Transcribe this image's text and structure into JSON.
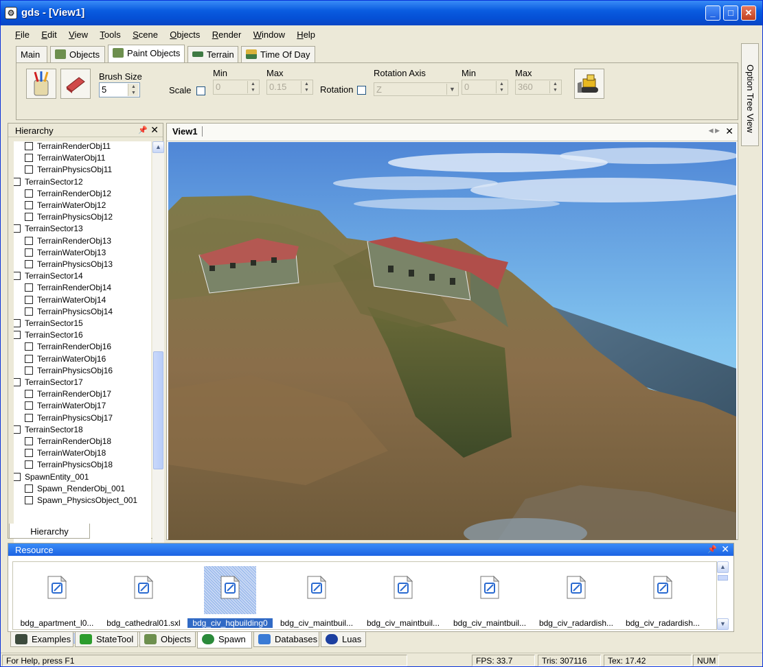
{
  "window": {
    "app_icon": "gds-app-icon",
    "title": "gds - [View1]",
    "min_label": "_",
    "max_label": "□",
    "close_label": "✕"
  },
  "menu": [
    "File",
    "Edit",
    "View",
    "Tools",
    "Scene",
    "Objects",
    "Render",
    "Window",
    "Help"
  ],
  "toolbar_tabs": [
    {
      "label": "Main",
      "icon": ""
    },
    {
      "label": "Objects",
      "icon": "objects-icon",
      "color": "#6d8f4e"
    },
    {
      "label": "Paint Objects",
      "icon": "paint-objects-icon",
      "color": "#6d8f4e"
    },
    {
      "label": "Terrain",
      "icon": "terrain-icon",
      "color": "#3f7a44"
    },
    {
      "label": "Time Of Day",
      "icon": "time-of-day-icon",
      "color": "#d9b23a"
    }
  ],
  "paint": {
    "brush_label": "Brush Size",
    "brush_value": "5",
    "scale_label": "Scale",
    "min_label": "Min",
    "max_label": "Max",
    "scale_min": "0",
    "scale_max": "0.15",
    "rotation_label": "Rotation",
    "rotation_axis_label": "Rotation Axis",
    "rotation_axis_value": "Z",
    "rot_min": "0",
    "rot_max": "360"
  },
  "option_tree": "Option Tree View",
  "hierarchy": {
    "title": "Hierarchy",
    "tab_label": "Hierarchy",
    "rows": [
      {
        "label": "TerrainRenderObj11",
        "indent": 1
      },
      {
        "label": "TerrainWaterObj11",
        "indent": 1
      },
      {
        "label": "TerrainPhysicsObj11",
        "indent": 1
      },
      {
        "label": "TerrainSector12",
        "indent": 0
      },
      {
        "label": "TerrainRenderObj12",
        "indent": 1
      },
      {
        "label": "TerrainWaterObj12",
        "indent": 1
      },
      {
        "label": "TerrainPhysicsObj12",
        "indent": 1
      },
      {
        "label": "TerrainSector13",
        "indent": 0
      },
      {
        "label": "TerrainRenderObj13",
        "indent": 1
      },
      {
        "label": "TerrainWaterObj13",
        "indent": 1
      },
      {
        "label": "TerrainPhysicsObj13",
        "indent": 1
      },
      {
        "label": "TerrainSector14",
        "indent": 0
      },
      {
        "label": "TerrainRenderObj14",
        "indent": 1
      },
      {
        "label": "TerrainWaterObj14",
        "indent": 1
      },
      {
        "label": "TerrainPhysicsObj14",
        "indent": 1
      },
      {
        "label": "TerrainSector15",
        "indent": 0
      },
      {
        "label": "TerrainSector16",
        "indent": 0
      },
      {
        "label": "TerrainRenderObj16",
        "indent": 1
      },
      {
        "label": "TerrainWaterObj16",
        "indent": 1
      },
      {
        "label": "TerrainPhysicsObj16",
        "indent": 1
      },
      {
        "label": "TerrainSector17",
        "indent": 0
      },
      {
        "label": "TerrainRenderObj17",
        "indent": 1
      },
      {
        "label": "TerrainWaterObj17",
        "indent": 1
      },
      {
        "label": "TerrainPhysicsObj17",
        "indent": 1
      },
      {
        "label": "TerrainSector18",
        "indent": 0
      },
      {
        "label": "TerrainRenderObj18",
        "indent": 1
      },
      {
        "label": "TerrainWaterObj18",
        "indent": 1
      },
      {
        "label": "TerrainPhysicsObj18",
        "indent": 1
      },
      {
        "label": "SpawnEntity_001",
        "indent": 0
      },
      {
        "label": "Spawn_RenderObj_001",
        "indent": 1
      },
      {
        "label": "Spawn_PhysicsObject_001",
        "indent": 1
      }
    ]
  },
  "view": {
    "tab": "View1"
  },
  "resource": {
    "title": "Resource",
    "items": [
      {
        "label": "bdg_apartment_l0...",
        "selected": false
      },
      {
        "label": "bdg_cathedral01.sxl",
        "selected": false
      },
      {
        "label": "bdg_civ_hqbuilding0",
        "selected": true
      },
      {
        "label": "bdg_civ_maintbuil...",
        "selected": false
      },
      {
        "label": "bdg_civ_maintbuil...",
        "selected": false
      },
      {
        "label": "bdg_civ_maintbuil...",
        "selected": false
      },
      {
        "label": "bdg_civ_radardish...",
        "selected": false
      },
      {
        "label": "bdg_civ_radardish...",
        "selected": false
      }
    ]
  },
  "bottom_tabs": [
    {
      "label": "Examples",
      "icon": "examples-icon",
      "color": "#3c4a3c"
    },
    {
      "label": "StateTool",
      "icon": "state-tool-icon",
      "color": "#2c9c2c"
    },
    {
      "label": "Objects",
      "icon": "objects-icon",
      "color": "#6d8f4e"
    },
    {
      "label": "Spawn",
      "icon": "spawn-icon",
      "color": "#2b8a3a"
    },
    {
      "label": "Databases",
      "icon": "databases-icon",
      "color": "#3a7bd5"
    },
    {
      "label": "Luas",
      "icon": "lua-icon",
      "color": "#1c3fa0"
    }
  ],
  "status": {
    "help": "For Help, press F1",
    "fps": "FPS: 33.7",
    "tris": "Tris: 307116",
    "tex": "Tex: 17.42",
    "num": "NUM"
  }
}
